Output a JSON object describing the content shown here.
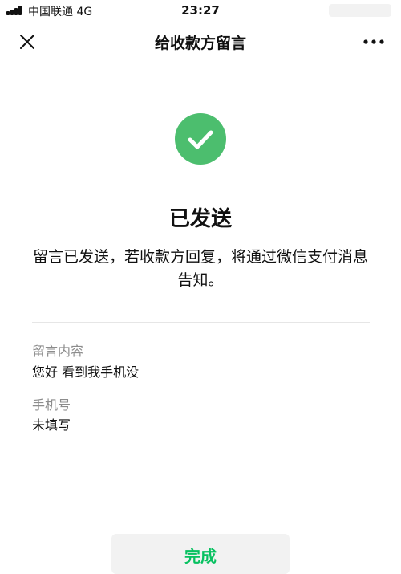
{
  "status_bar": {
    "carrier": "中国联通  4G",
    "time": "23:27",
    "signal_icon": "signal-bars-icon"
  },
  "nav": {
    "title": "给收款方留言",
    "close_icon": "close-icon",
    "more_icon": "more-dots-icon"
  },
  "result": {
    "icon": "check-circle-icon",
    "title": "已发送",
    "description": "留言已发送，若收款方回复，将通过微信支付消息告知。"
  },
  "details": {
    "message_label": "留言内容",
    "message_value": "您好 看到我手机没",
    "phone_label": "手机号",
    "phone_value": "未填写"
  },
  "actions": {
    "done_label": "完成"
  },
  "colors": {
    "accent_green": "#07c160",
    "icon_green": "#4cbe6e",
    "muted_text": "#8c8c8c",
    "button_bg": "#f2f2f2"
  }
}
